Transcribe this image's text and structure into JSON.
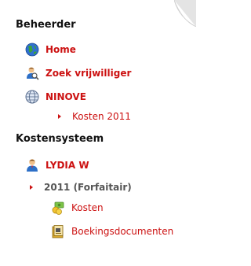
{
  "colors": {
    "link_red": "#cc1111",
    "heading": "#111111",
    "muted": "#555555"
  },
  "sections": {
    "beheerder": {
      "title": "Beheerder",
      "items": {
        "home": {
          "label": "Home",
          "icon": "globe-icon"
        },
        "zoek": {
          "label": "Zoek vrijwilliger",
          "icon": "search-user-icon"
        },
        "ninove": {
          "label": "NINOVE",
          "icon": "world-grid-icon"
        },
        "kosten2011": {
          "label": "Kosten 2011",
          "icon": "bullet-arrow-icon"
        }
      }
    },
    "kostensysteem": {
      "title": "Kostensysteem",
      "items": {
        "lydia": {
          "label": "LYDIA W",
          "icon": "user-icon"
        },
        "forfaitair": {
          "label": "2011 (Forfaitair)",
          "icon": "bullet-arrow-icon"
        },
        "kosten": {
          "label": "Kosten",
          "icon": "money-icon"
        },
        "boekingsdocumenten": {
          "label": "Boekingsdocumenten",
          "icon": "document-folder-icon"
        }
      }
    }
  }
}
